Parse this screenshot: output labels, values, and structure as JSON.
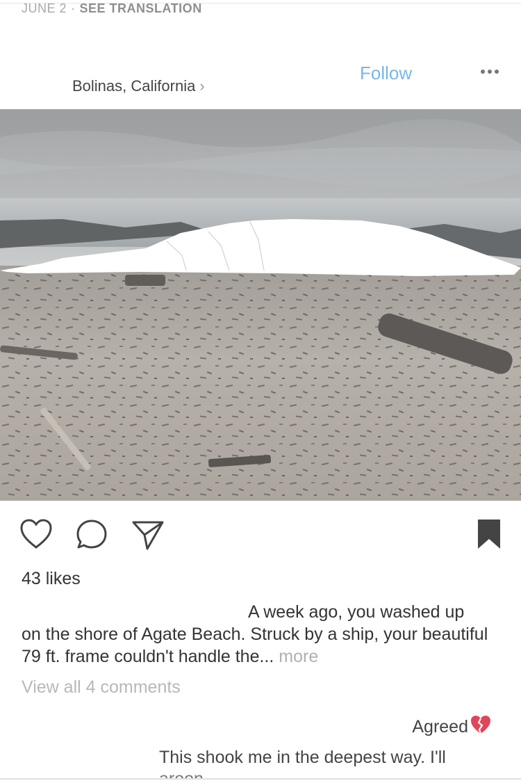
{
  "prev_post": {
    "date": "JUNE 2",
    "separator": "·",
    "see_translation": "SEE TRANSLATION"
  },
  "header": {
    "location": "Bolinas, California",
    "location_chevron": "›",
    "follow_label": "Follow",
    "more_icon": "more-horizontal-icon"
  },
  "post": {
    "image_description_icon": "beach-photo"
  },
  "actions": {
    "like_icon": "heart-outline-icon",
    "comment_icon": "comment-bubble-icon",
    "share_icon": "paper-plane-icon",
    "save_icon": "bookmark-filled-icon"
  },
  "likes": "43 likes",
  "caption": {
    "line1": "A week ago, you washed up",
    "rest": "on the shore of Agate Beach. Struck by a ship, your beautiful 79 ft. frame couldn't handle the...",
    "more": "more"
  },
  "view_all_comments": "View all 4 comments",
  "comments": [
    {
      "text": "Agreed",
      "emoji": "broken-heart-icon"
    },
    {
      "text": "This shook me in the deepest way. I'll",
      "overflow": "aroon"
    }
  ],
  "colors": {
    "follow": "#79b6ea",
    "muted": "#b0b0b0",
    "icon": "#444444"
  }
}
